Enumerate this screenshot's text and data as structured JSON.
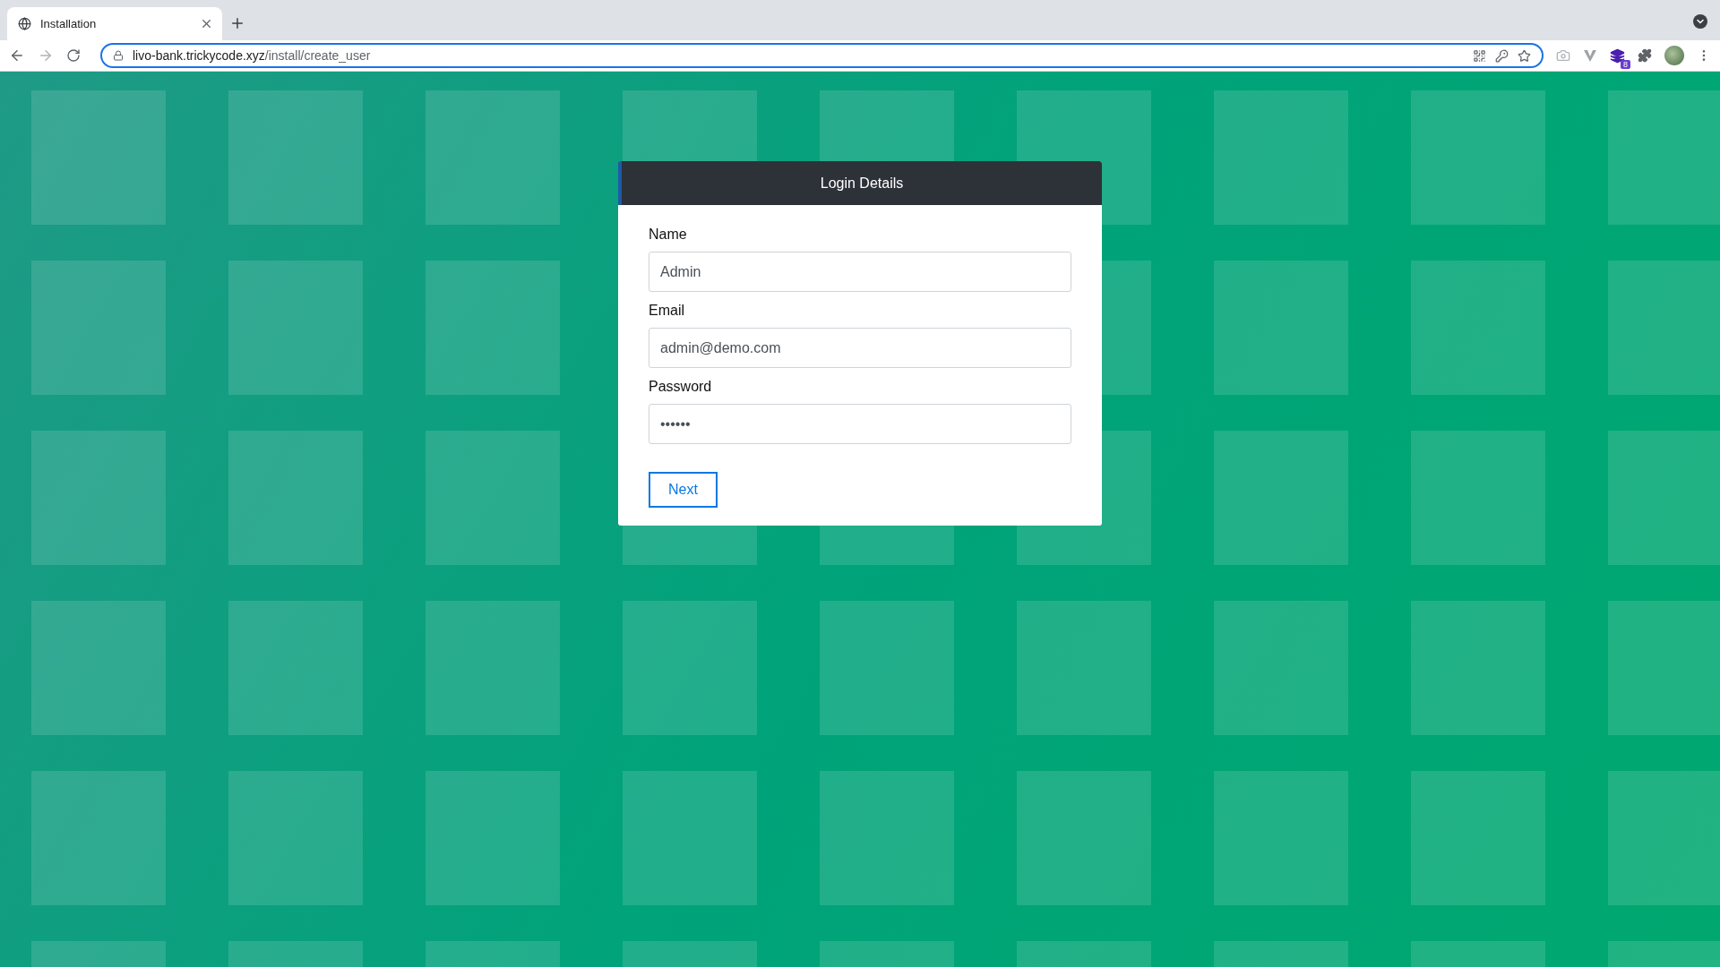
{
  "browser": {
    "tab": {
      "title": "Installation",
      "selected": true
    },
    "address": {
      "domain": "livo-bank.trickycode.xyz",
      "path": "/install/create_user"
    },
    "forward_disabled": true,
    "extension_badge": "8"
  },
  "card": {
    "title": "Login Details",
    "fields": [
      {
        "label": "Name",
        "value": "Admin"
      },
      {
        "label": "Email",
        "value": "admin@demo.com"
      },
      {
        "label": "Password",
        "value": "••••••"
      }
    ],
    "button": "Next"
  }
}
